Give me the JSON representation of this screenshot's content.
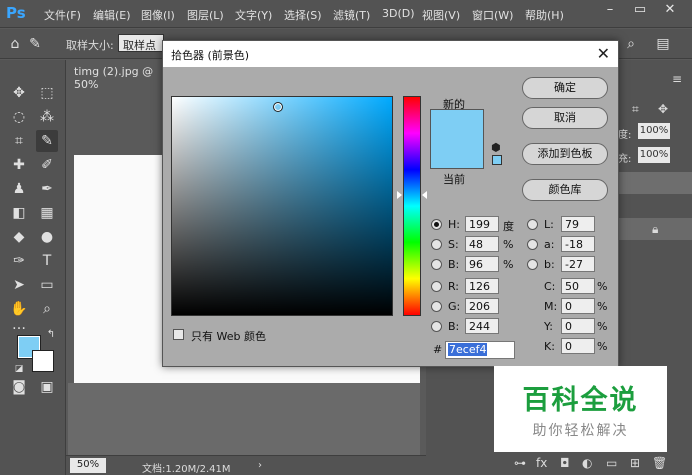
{
  "app": {
    "logo": "Ps",
    "menu": [
      "文件(F)",
      "编辑(E)",
      "图像(I)",
      "图层(L)",
      "文字(Y)",
      "选择(S)",
      "滤镜(T)",
      "3D(D)",
      "视图(V)",
      "窗口(W)",
      "帮助(H)"
    ],
    "window_controls": [
      "minimize-icon",
      "maximize-icon",
      "close-icon"
    ]
  },
  "options_bar": {
    "sample_size_label": "取样大小:",
    "sample_size_value": "取样点"
  },
  "document": {
    "tab_title": "timg (2).jpg @ 50%",
    "zoom": "50%",
    "doc_info": "文档:1.20M/2.41M"
  },
  "right_panel": {
    "opacity_value": "100%",
    "fill_value": "100%",
    "opacity_label": "度:",
    "fill_label": "充:"
  },
  "dialog": {
    "title": "拾色器 (前景色)",
    "new_label": "新的",
    "current_label": "当前",
    "new_color": "#7ecef4",
    "current_color": "#7ecef4",
    "hue_color": "#00aaff",
    "buttons": {
      "ok": "确定",
      "cancel": "取消",
      "add_swatch": "添加到色板",
      "libraries": "颜色库"
    },
    "web_only_label": "只有 Web 颜色",
    "fields": {
      "H": {
        "label": "H:",
        "value": "199",
        "unit": "度"
      },
      "S": {
        "label": "S:",
        "value": "48",
        "unit": "%"
      },
      "Bv": {
        "label": "B:",
        "value": "96",
        "unit": "%"
      },
      "R": {
        "label": "R:",
        "value": "126"
      },
      "G": {
        "label": "G:",
        "value": "206"
      },
      "Bc": {
        "label": "B:",
        "value": "244"
      },
      "L": {
        "label": "L:",
        "value": "79"
      },
      "a": {
        "label": "a:",
        "value": "-18"
      },
      "b": {
        "label": "b:",
        "value": "-27"
      },
      "C": {
        "label": "C:",
        "value": "50",
        "unit": "%"
      },
      "M": {
        "label": "M:",
        "value": "0",
        "unit": "%"
      },
      "Y": {
        "label": "Y:",
        "value": "0",
        "unit": "%"
      },
      "K": {
        "label": "K:",
        "value": "0",
        "unit": "%"
      }
    },
    "hex_prefix": "#",
    "hex_value": "7ecef4"
  },
  "watermark": {
    "main": "百科全说",
    "sub": "助你轻松解决"
  }
}
